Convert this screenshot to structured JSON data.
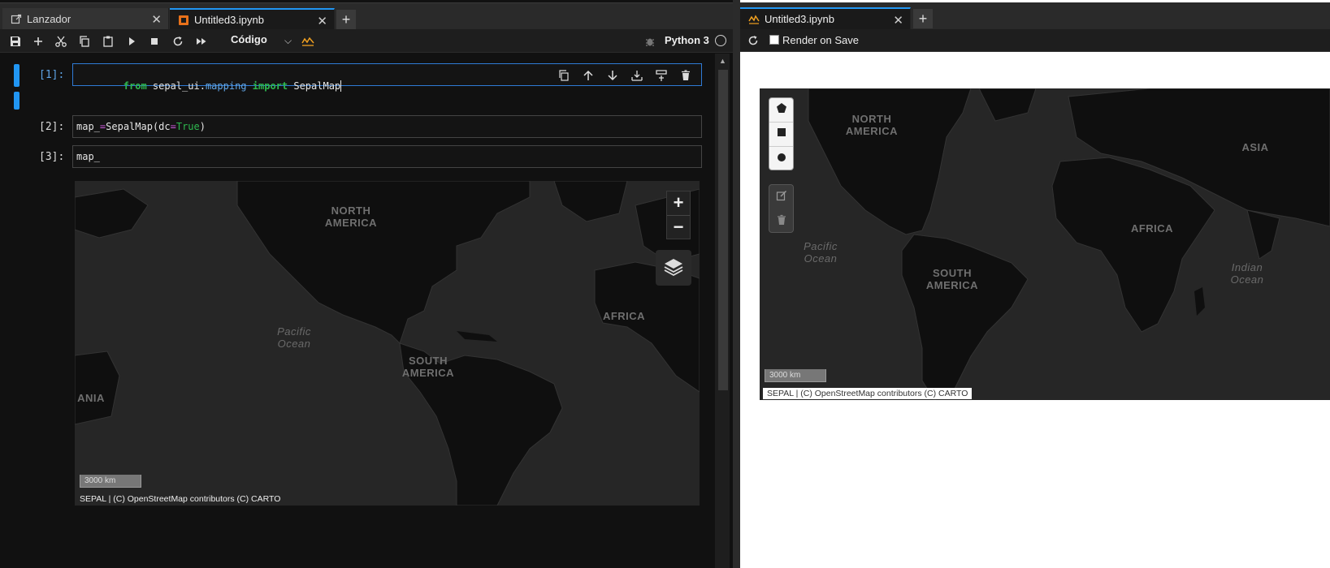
{
  "left": {
    "tabs": [
      {
        "label": "Lanzador",
        "icon": "external-link-icon"
      },
      {
        "label": "Untitled3.ipynb",
        "icon": "notebook-icon"
      }
    ],
    "toolbar": {
      "cell_type": "Código",
      "kernel": "Python 3"
    },
    "cells": [
      {
        "prompt": "[1]:",
        "code": "from sepal_ui.mapping import SepalMap"
      },
      {
        "prompt": "[2]:",
        "code": "map_=SepalMap(dc=True)"
      },
      {
        "prompt": "[3]:",
        "code": "map_"
      }
    ],
    "map": {
      "labels": {
        "north_america": "NORTH\nAMERICA",
        "south_america": "SOUTH\nAMERICA",
        "africa": "AFRICA",
        "pacific": "Pacific\nOcean",
        "oceania": "ANIA"
      },
      "zoom_in": "+",
      "zoom_out": "−",
      "scale": "3000 km",
      "attribution": "SEPAL | (C) OpenStreetMap contributors (C) CARTO"
    }
  },
  "right": {
    "tab": {
      "label": "Untitled3.ipynb",
      "icon": "voila-icon"
    },
    "render_on_save": "Render on Save",
    "render_on_save_checked": false,
    "map": {
      "labels": {
        "north_america": "NORTH\nAMERICA",
        "south_america": "SOUTH\nAMERICA",
        "africa": "AFRICA",
        "asia": "ASIA",
        "pacific": "Pacific\nOcean",
        "indian": "Indian\nOcean"
      },
      "scale": "3000 km",
      "attribution": "SEPAL | (C) OpenStreetMap contributors (C) CARTO"
    }
  },
  "colors": {
    "accent": "#2196f3",
    "background": "#111111",
    "map_land": "#0f0f0f",
    "map_water": "#262626"
  }
}
